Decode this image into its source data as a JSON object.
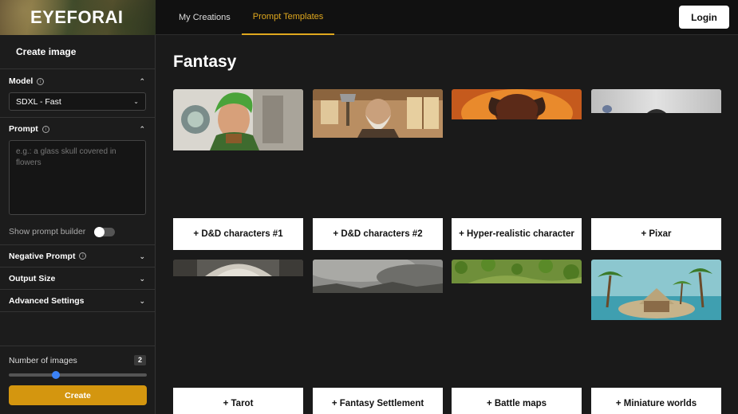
{
  "header": {
    "logo": "EYEFORAI",
    "tabs": [
      {
        "label": "My Creations"
      },
      {
        "label": "Prompt Templates"
      }
    ],
    "login_label": "Login"
  },
  "sidebar": {
    "title": "Create image",
    "model": {
      "label": "Model",
      "value": "SDXL - Fast"
    },
    "prompt": {
      "label": "Prompt",
      "placeholder": "e.g.: a glass skull covered in flowers"
    },
    "show_prompt_builder": {
      "label": "Show prompt builder",
      "enabled": false
    },
    "negative_prompt": {
      "label": "Negative Prompt"
    },
    "output_size": {
      "label": "Output Size"
    },
    "advanced_settings": {
      "label": "Advanced Settings"
    },
    "num_images": {
      "label": "Number of images",
      "value": "2"
    },
    "create_label": "Create"
  },
  "main": {
    "title": "Fantasy",
    "templates": [
      {
        "label": "+ D&D characters #1"
      },
      {
        "label": "+ D&D characters #2"
      },
      {
        "label": "+ Hyper-realistic character"
      },
      {
        "label": "+ Pixar"
      },
      {
        "label": "+ Tarot"
      },
      {
        "label": "+ Fantasy Settlement"
      },
      {
        "label": "+ Battle maps"
      },
      {
        "label": "+ Miniature worlds"
      }
    ]
  },
  "colors": {
    "accent": "#e0a81e",
    "create_button": "#d4960f",
    "slider": "#3b82f6"
  }
}
